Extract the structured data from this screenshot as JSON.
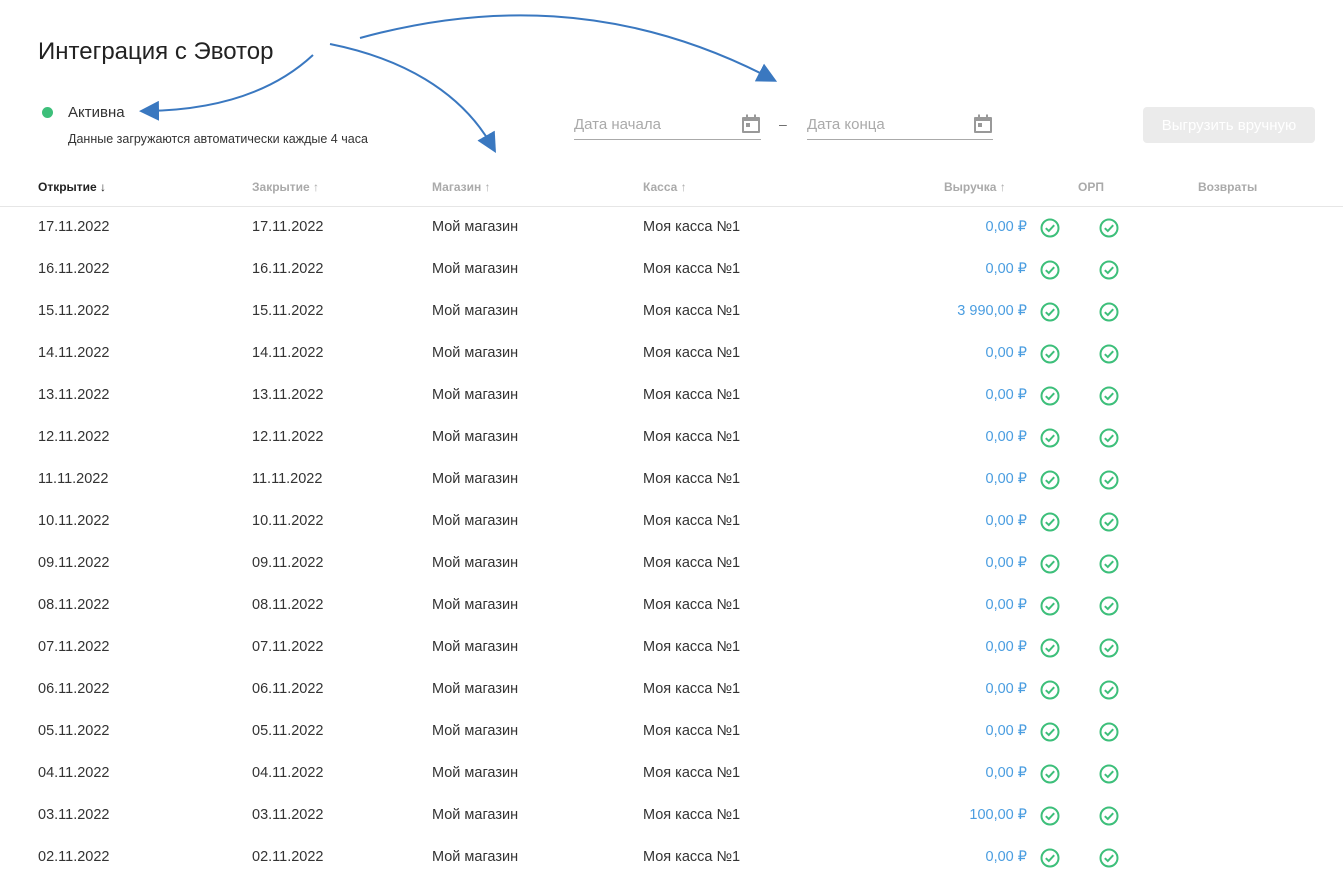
{
  "title": "Интеграция с Эвотор",
  "status": {
    "label": "Активна",
    "note": "Данные загружаются автоматически каждые 4 часа",
    "color": "#3dbf7a"
  },
  "filters": {
    "start_placeholder": "Дата начала",
    "end_placeholder": "Дата конца",
    "separator": "–",
    "export_button": "Выгрузить вручную"
  },
  "columns": {
    "open": "Открытие ↓",
    "close": "Закрытие ↑",
    "shop": "Магазин ↑",
    "register": "Касса ↑",
    "revenue": "Выручка ↑",
    "orp": "ОРП",
    "returns": "Возвраты"
  },
  "rows": [
    {
      "open": "17.11.2022",
      "close": "17.11.2022",
      "shop": "Мой магазин",
      "register": "Моя касса №1",
      "revenue": "0,00 ₽"
    },
    {
      "open": "16.11.2022",
      "close": "16.11.2022",
      "shop": "Мой магазин",
      "register": "Моя касса №1",
      "revenue": "0,00 ₽"
    },
    {
      "open": "15.11.2022",
      "close": "15.11.2022",
      "shop": "Мой магазин",
      "register": "Моя касса №1",
      "revenue": "3 990,00 ₽"
    },
    {
      "open": "14.11.2022",
      "close": "14.11.2022",
      "shop": "Мой магазин",
      "register": "Моя касса №1",
      "revenue": "0,00 ₽"
    },
    {
      "open": "13.11.2022",
      "close": "13.11.2022",
      "shop": "Мой магазин",
      "register": "Моя касса №1",
      "revenue": "0,00 ₽"
    },
    {
      "open": "12.11.2022",
      "close": "12.11.2022",
      "shop": "Мой магазин",
      "register": "Моя касса №1",
      "revenue": "0,00 ₽"
    },
    {
      "open": "11.11.2022",
      "close": "11.11.2022",
      "shop": "Мой магазин",
      "register": "Моя касса №1",
      "revenue": "0,00 ₽"
    },
    {
      "open": "10.11.2022",
      "close": "10.11.2022",
      "shop": "Мой магазин",
      "register": "Моя касса №1",
      "revenue": "0,00 ₽"
    },
    {
      "open": "09.11.2022",
      "close": "09.11.2022",
      "shop": "Мой магазин",
      "register": "Моя касса №1",
      "revenue": "0,00 ₽"
    },
    {
      "open": "08.11.2022",
      "close": "08.11.2022",
      "shop": "Мой магазин",
      "register": "Моя касса №1",
      "revenue": "0,00 ₽"
    },
    {
      "open": "07.11.2022",
      "close": "07.11.2022",
      "shop": "Мой магазин",
      "register": "Моя касса №1",
      "revenue": "0,00 ₽"
    },
    {
      "open": "06.11.2022",
      "close": "06.11.2022",
      "shop": "Мой магазин",
      "register": "Моя касса №1",
      "revenue": "0,00 ₽"
    },
    {
      "open": "05.11.2022",
      "close": "05.11.2022",
      "shop": "Мой магазин",
      "register": "Моя касса №1",
      "revenue": "0,00 ₽"
    },
    {
      "open": "04.11.2022",
      "close": "04.11.2022",
      "shop": "Мой магазин",
      "register": "Моя касса №1",
      "revenue": "0,00 ₽"
    },
    {
      "open": "03.11.2022",
      "close": "03.11.2022",
      "shop": "Мой магазин",
      "register": "Моя касса №1",
      "revenue": "100,00 ₽"
    },
    {
      "open": "02.11.2022",
      "close": "02.11.2022",
      "shop": "Мой магазин",
      "register": "Моя касса №1",
      "revenue": "0,00 ₽"
    }
  ],
  "colors": {
    "accent": "#4a9de0",
    "check": "#3dbf7a",
    "annotation": "#3a78c0"
  }
}
